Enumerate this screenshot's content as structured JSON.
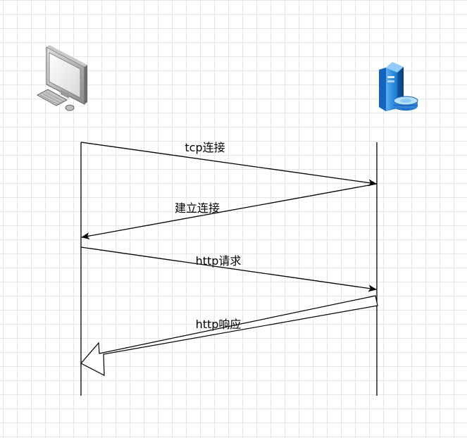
{
  "diagram": {
    "type": "sequence",
    "participants": [
      {
        "name": "client",
        "icon": "desktop-computer-icon"
      },
      {
        "name": "server",
        "icon": "server-database-icon"
      }
    ],
    "messages": [
      {
        "label": "tcp连接",
        "from": "client",
        "to": "server",
        "arrow": "line"
      },
      {
        "label": "建立连接",
        "from": "server",
        "to": "client",
        "arrow": "line"
      },
      {
        "label": "http请求",
        "from": "client",
        "to": "server",
        "arrow": "line"
      },
      {
        "label": "http响应",
        "from": "server",
        "to": "client",
        "arrow": "block"
      }
    ]
  },
  "colors": {
    "background": "#ffffff",
    "grid": "#e6e6e6",
    "line": "#000000",
    "server_blue": "#1e88e5"
  }
}
